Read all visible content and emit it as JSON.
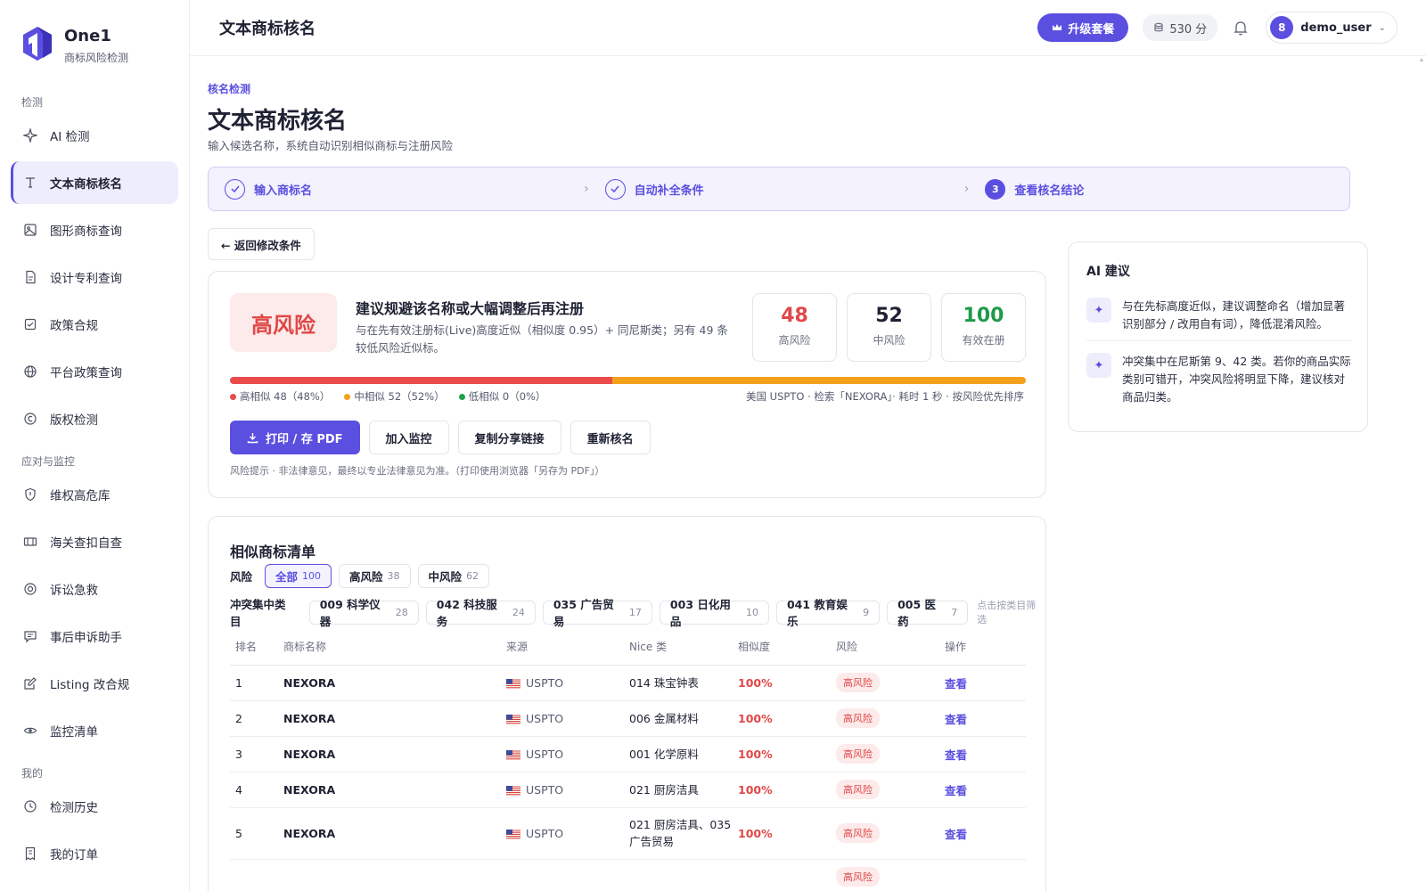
{
  "brand": {
    "name": "One1",
    "subtitle": "商标风险检测"
  },
  "sidebar": {
    "sections": [
      {
        "title": "检测",
        "items": [
          {
            "label": "AI 检测",
            "icon": "sparkle-icon"
          },
          {
            "label": "文本商标核名",
            "icon": "text-icon",
            "active": true
          },
          {
            "label": "图形商标查询",
            "icon": "image-icon"
          },
          {
            "label": "设计专利查询",
            "icon": "document-icon"
          },
          {
            "label": "政策合规",
            "icon": "checklist-icon"
          },
          {
            "label": "平台政策查询",
            "icon": "globe-icon"
          },
          {
            "label": "版权检测",
            "icon": "copyright-icon"
          }
        ]
      },
      {
        "title": "应对与监控",
        "items": [
          {
            "label": "维权高危库",
            "icon": "shield-icon"
          },
          {
            "label": "海关查扣自查",
            "icon": "customs-icon"
          },
          {
            "label": "诉讼急救",
            "icon": "lifebuoy-icon"
          },
          {
            "label": "事后申诉助手",
            "icon": "message-icon"
          },
          {
            "label": "Listing 改合规",
            "icon": "edit-icon"
          },
          {
            "label": "监控清单",
            "icon": "eye-icon"
          }
        ]
      },
      {
        "title": "我的",
        "items": [
          {
            "label": "检测历史",
            "icon": "clock-icon"
          },
          {
            "label": "我的订单",
            "icon": "receipt-icon"
          }
        ]
      }
    ]
  },
  "header": {
    "title": "文本商标核名",
    "upgrade_label": "升级套餐",
    "points": "530 分",
    "user_initial": "8",
    "username": "demo_user"
  },
  "page": {
    "breadcrumb": "核名检测",
    "title": "文本商标核名",
    "subtitle": "输入候选名称，系统自动识别相似商标与注册风险",
    "steps": [
      {
        "label": "输入商标名",
        "state": "done"
      },
      {
        "label": "自动补全条件",
        "state": "done"
      },
      {
        "label": "查看核名结论",
        "state": "current",
        "num": "3"
      }
    ],
    "back_label": "← 返回修改条件"
  },
  "result": {
    "risk_level": "高风险",
    "headline": "建议规避该名称或大幅调整后再注册",
    "description": "与在先有效注册标(Live)高度近似（相似度 0.95）+ 同尼斯类；另有 49 条较低风险近似标。",
    "stats": [
      {
        "value": "48",
        "label": "高风险",
        "color": "#e04848"
      },
      {
        "value": "52",
        "label": "中风险",
        "color": "#1e2233"
      },
      {
        "value": "100",
        "label": "有效在册",
        "color": "#1f9a4a"
      }
    ],
    "distribution": [
      {
        "label": "高相似 48（48%）",
        "share": 48,
        "color": "#e94b4b"
      },
      {
        "label": "中相似 52（52%）",
        "share": 52,
        "color": "#f3a11d"
      },
      {
        "label": "低相似 0（0%）",
        "share": 0,
        "color": "#22a04b"
      }
    ],
    "meta": "美国 USPTO · 检索「NEXORA」· 耗时 1 秒 · 按风险优先排序",
    "buttons": {
      "print": "打印 / 存 PDF",
      "monitor": "加入监控",
      "share": "复制分享链接",
      "recheck": "重新核名"
    },
    "disclaimer": "风险提示 · 非法律意见，最终以专业法律意见为准。（打印使用浏览器「另存为 PDF」）"
  },
  "ai": {
    "title": "AI 建议",
    "items": [
      "与在先标高度近似，建议调整命名（增加显著识别部分 / 改用自有词），降低混淆风险。",
      "冲突集中在尼斯第 9、42 类。若你的商品实际类别可错开，冲突风险将明显下降，建议核对商品归类。"
    ]
  },
  "list": {
    "title": "相似商标清单",
    "risk_filter_label": "风险",
    "risk_filters": [
      {
        "label": "全部",
        "count": "100",
        "active": true
      },
      {
        "label": "高风险",
        "count": "38"
      },
      {
        "label": "中风险",
        "count": "62"
      }
    ],
    "class_filter_label": "冲突集中类目",
    "class_filters": [
      {
        "label": "009 科学仪器",
        "count": "28"
      },
      {
        "label": "042 科技服务",
        "count": "24"
      },
      {
        "label": "035 广告贸易",
        "count": "17"
      },
      {
        "label": "003 日化用品",
        "count": "10"
      },
      {
        "label": "041 教育娱乐",
        "count": "9"
      },
      {
        "label": "005 医药",
        "count": "7"
      }
    ],
    "class_hint": "点击按类目筛选",
    "columns": [
      "排名",
      "商标名称",
      "来源",
      "Nice 类",
      "相似度",
      "风险",
      "操作"
    ],
    "rows": [
      {
        "rank": "1",
        "name": "NEXORA",
        "source": "USPTO",
        "nice": "014 珠宝钟表",
        "sim": "100%",
        "risk": "高风险",
        "action": "查看"
      },
      {
        "rank": "2",
        "name": "NEXORA",
        "source": "USPTO",
        "nice": "006 金属材料",
        "sim": "100%",
        "risk": "高风险",
        "action": "查看"
      },
      {
        "rank": "3",
        "name": "NEXORA",
        "source": "USPTO",
        "nice": "001 化学原料",
        "sim": "100%",
        "risk": "高风险",
        "action": "查看"
      },
      {
        "rank": "4",
        "name": "NEXORA",
        "source": "USPTO",
        "nice": "021 厨房洁具",
        "sim": "100%",
        "risk": "高风险",
        "action": "查看"
      },
      {
        "rank": "5",
        "name": "NEXORA",
        "source": "USPTO",
        "nice": "021 厨房洁具、035 广告贸易",
        "sim": "100%",
        "risk": "高风险",
        "action": "查看"
      },
      {
        "rank": "",
        "name": "",
        "source": "",
        "nice": "",
        "sim": "",
        "risk": "高风险",
        "action": ""
      }
    ]
  }
}
